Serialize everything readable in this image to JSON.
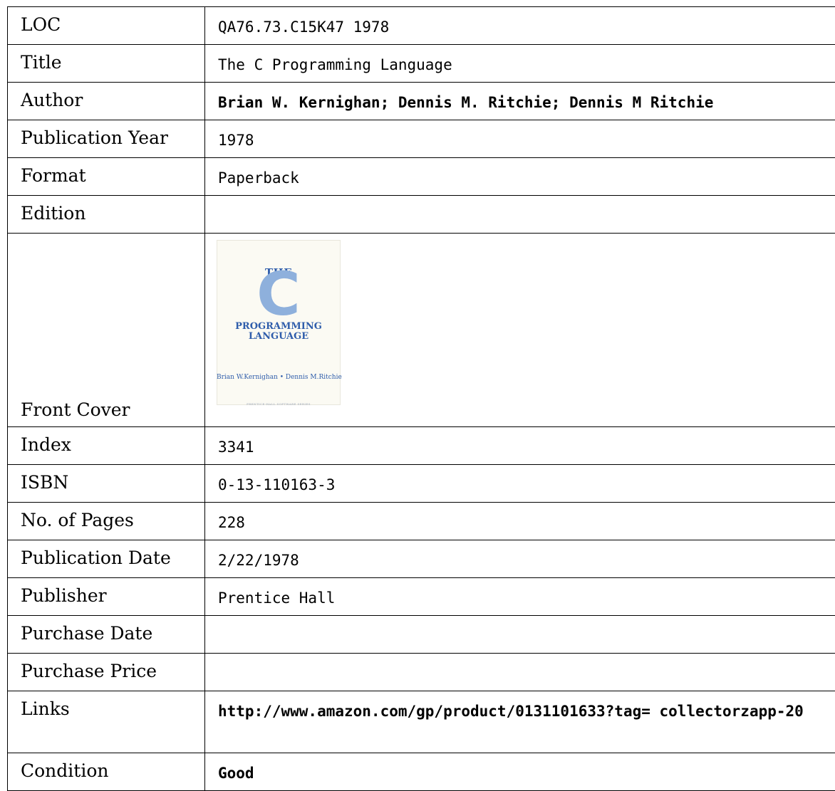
{
  "record": {
    "loc": {
      "label": "LOC",
      "value": "QA76.73.C15K47 1978"
    },
    "title": {
      "label": "Title",
      "value": "The C Programming Language"
    },
    "author": {
      "label": "Author",
      "value": "Brian W. Kernighan; Dennis M. Ritchie; Dennis M Ritchie"
    },
    "pub_year": {
      "label": "Publication Year",
      "value": "1978"
    },
    "format": {
      "label": "Format",
      "value": "Paperback"
    },
    "edition": {
      "label": "Edition",
      "value": ""
    },
    "front_cover": {
      "label": "Front Cover",
      "cover": {
        "the": "THE",
        "letter": "C",
        "line1": "PROGRAMMING",
        "line2": "LANGUAGE",
        "authors": "Brian W.Kernighan • Dennis M.Ritchie",
        "series": "PRENTICE-HALL SOFTWARE SERIES"
      }
    },
    "index": {
      "label": "Index",
      "value": "3341"
    },
    "isbn": {
      "label": "ISBN",
      "value": "0-13-110163-3"
    },
    "pages": {
      "label": "No. of Pages",
      "value": "228"
    },
    "pub_date": {
      "label": "Publication Date",
      "value": "2/22/1978"
    },
    "publisher": {
      "label": "Publisher",
      "value": "Prentice Hall"
    },
    "purchase_date": {
      "label": "Purchase Date",
      "value": ""
    },
    "purchase_price": {
      "label": "Purchase Price",
      "value": ""
    },
    "links": {
      "label": "Links",
      "value": "http://www.amazon.com/gp/product/0131101633?tag= collectorzapp-20"
    },
    "condition": {
      "label": "Condition",
      "value": "Good"
    }
  },
  "colors": {
    "cover_blue": "#2f5dab",
    "cover_light_blue": "#8eb0dc",
    "cover_bg": "#fbfaf3"
  }
}
